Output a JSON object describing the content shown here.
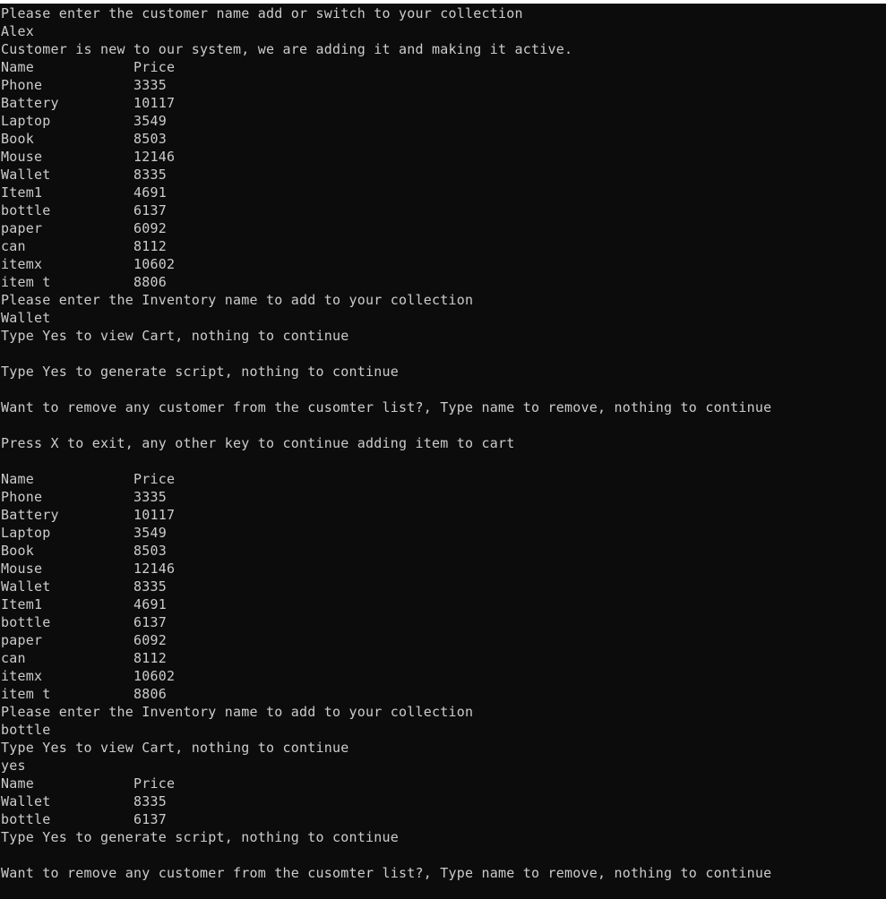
{
  "terminal": {
    "lines": [
      "Please enter the customer name add or switch to your collection",
      "Alex",
      "Customer is new to our system, we are adding it and making it active.",
      "Name            Price",
      "Phone           3335",
      "Battery         10117",
      "Laptop          3549",
      "Book            8503",
      "Mouse           12146",
      "Wallet          8335",
      "Item1           4691",
      "bottle          6137",
      "paper           6092",
      "can             8112",
      "itemx           10602",
      "item t          8806",
      "Please enter the Inventory name to add to your collection",
      "Wallet",
      "Type Yes to view Cart, nothing to continue",
      "",
      "Type Yes to generate script, nothing to continue",
      "",
      "Want to remove any customer from the cusomter list?, Type name to remove, nothing to continue",
      "",
      "Press X to exit, any other key to continue adding item to cart",
      "",
      "Name            Price",
      "Phone           3335",
      "Battery         10117",
      "Laptop          3549",
      "Book            8503",
      "Mouse           12146",
      "Wallet          8335",
      "Item1           4691",
      "bottle          6137",
      "paper           6092",
      "can             8112",
      "itemx           10602",
      "item t          8806",
      "Please enter the Inventory name to add to your collection",
      "bottle",
      "Type Yes to view Cart, nothing to continue",
      "yes",
      "Name            Price",
      "Wallet          8335",
      "bottle          6137",
      "Type Yes to generate script, nothing to continue",
      "",
      "Want to remove any customer from the cusomter list?, Type name to remove, nothing to continue"
    ]
  }
}
